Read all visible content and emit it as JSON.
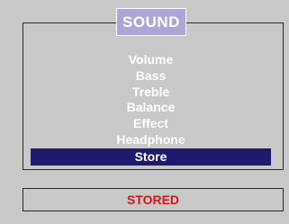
{
  "menu": {
    "title": "SOUND",
    "items": [
      {
        "label": "Volume",
        "selected": false
      },
      {
        "label": "Bass",
        "selected": false
      },
      {
        "label": "Treble",
        "selected": false
      },
      {
        "label": "Balance",
        "selected": false
      },
      {
        "label": "Effect",
        "selected": false
      },
      {
        "label": "Headphone",
        "selected": false
      },
      {
        "label": "Store",
        "selected": true
      }
    ]
  },
  "status": {
    "text": "STORED"
  },
  "colors": {
    "background": "#c8c8c8",
    "title_tab": "#aaa6d8",
    "selection_bar": "#1f1a6e",
    "status_text": "#d4141b"
  }
}
